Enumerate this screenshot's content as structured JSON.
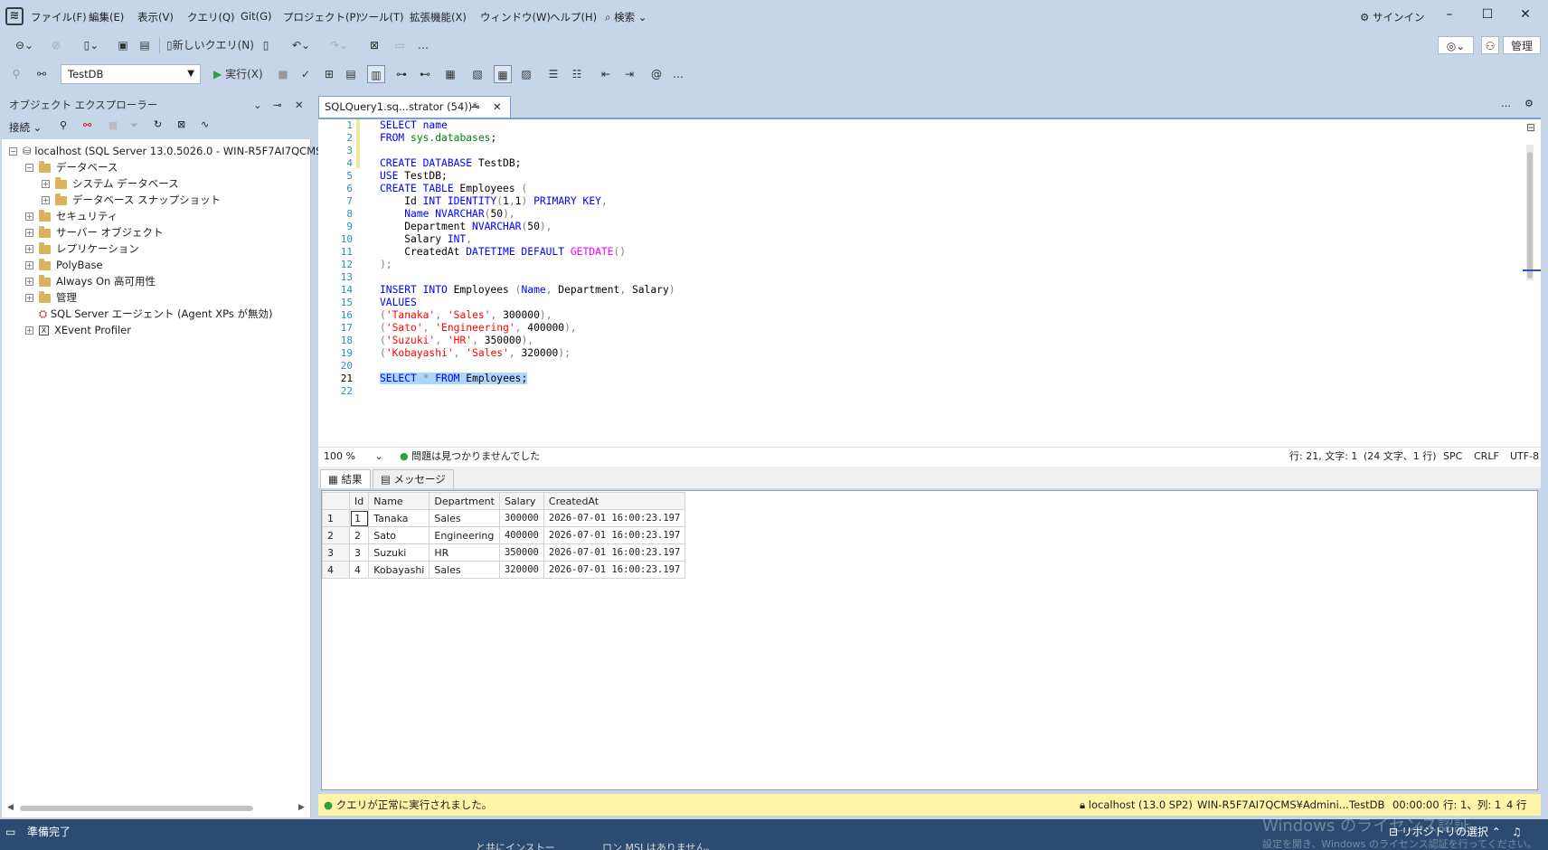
{
  "menu": [
    "ファイル(F)",
    "編集(E)",
    "表示(V)",
    "クエリ(Q)",
    "Git(G)",
    "プロジェクト(P)",
    "ツール(T)",
    "拡張機能(X)",
    "ウィンドウ(W)",
    "ヘルプ(H)"
  ],
  "search_label": "検索",
  "signin_label": "サインイン",
  "admin_label": "管理",
  "toolbar": {
    "new_query_label": "新しいクエリ(N)",
    "execute_label": "実行(X)",
    "database": "TestDB"
  },
  "object_explorer": {
    "title": "オブジェクト エクスプローラー",
    "connect_label": "接続",
    "tree": [
      {
        "label": "localhost (SQL Server 13.0.5026.0 - WIN-R5F7AI7QCMS¥A"
      },
      {
        "label": "データベース"
      },
      {
        "label": "システム データベース"
      },
      {
        "label": "データベース スナップショット"
      },
      {
        "label": "セキュリティ"
      },
      {
        "label": "サーバー オブジェクト"
      },
      {
        "label": "レプリケーション"
      },
      {
        "label": "PolyBase"
      },
      {
        "label": "Always On 高可用性"
      },
      {
        "label": "管理"
      },
      {
        "label": "SQL Server エージェント (Agent XPs が無効)"
      },
      {
        "label": "XEvent Profiler"
      }
    ]
  },
  "editor": {
    "tab_title": "SQLQuery1.sq...strator (54))*",
    "line_numbers": [
      "1",
      "2",
      "3",
      "4",
      "5",
      "6",
      "7",
      "8",
      "9",
      "10",
      "11",
      "12",
      "13",
      "14",
      "15",
      "16",
      "17",
      "18",
      "19",
      "20",
      "21",
      "22"
    ],
    "zoom": "100 %",
    "issues": "問題は見つかりませんでした",
    "cursor_pos": "行: 21, 文字: 1",
    "selection_info": "(24 文字、1 行)",
    "indent": "SPC",
    "line_ending": "CRLF",
    "encoding": "UTF-8"
  },
  "results": {
    "tab_results": "結果",
    "tab_messages": "メッセージ",
    "columns": [
      "Id",
      "Name",
      "Department",
      "Salary",
      "CreatedAt"
    ],
    "rows": [
      {
        "rownum": "1",
        "id": "1",
        "name": "Tanaka",
        "dept": "Sales",
        "salary": "300000",
        "created": "2026-07-01 16:00:23.197"
      },
      {
        "rownum": "2",
        "id": "2",
        "name": "Sato",
        "dept": "Engineering",
        "salary": "400000",
        "created": "2026-07-01 16:00:23.197"
      },
      {
        "rownum": "3",
        "id": "3",
        "name": "Suzuki",
        "dept": "HR",
        "salary": "350000",
        "created": "2026-07-01 16:00:23.197"
      },
      {
        "rownum": "4",
        "id": "4",
        "name": "Kobayashi",
        "dept": "Sales",
        "salary": "320000",
        "created": "2026-07-01 16:00:23.197"
      }
    ]
  },
  "query_status": {
    "message": "クエリが正常に実行されました。",
    "server": "localhost (13.0 SP2)",
    "user": "WIN-R5F7AI7QCMS¥Admini...",
    "database": "TestDB",
    "elapsed": "00:00:00",
    "position": "行: 1、列: 1",
    "rows": "4 行"
  },
  "app_status": {
    "ready": "準備完了",
    "watermark": "Windows のライセンス認証",
    "watermark2": "設定を開き、Windows のライセンス認証を行ってください。",
    "repo": "リポジトリの選択",
    "behind_text": "と共にインストー",
    "behind_text2": "ロン MSI はありません。"
  },
  "colors": {
    "accent": "#7aa2d6",
    "status_yellow": "#fff4a8",
    "statusbar": "#2b4b70"
  }
}
